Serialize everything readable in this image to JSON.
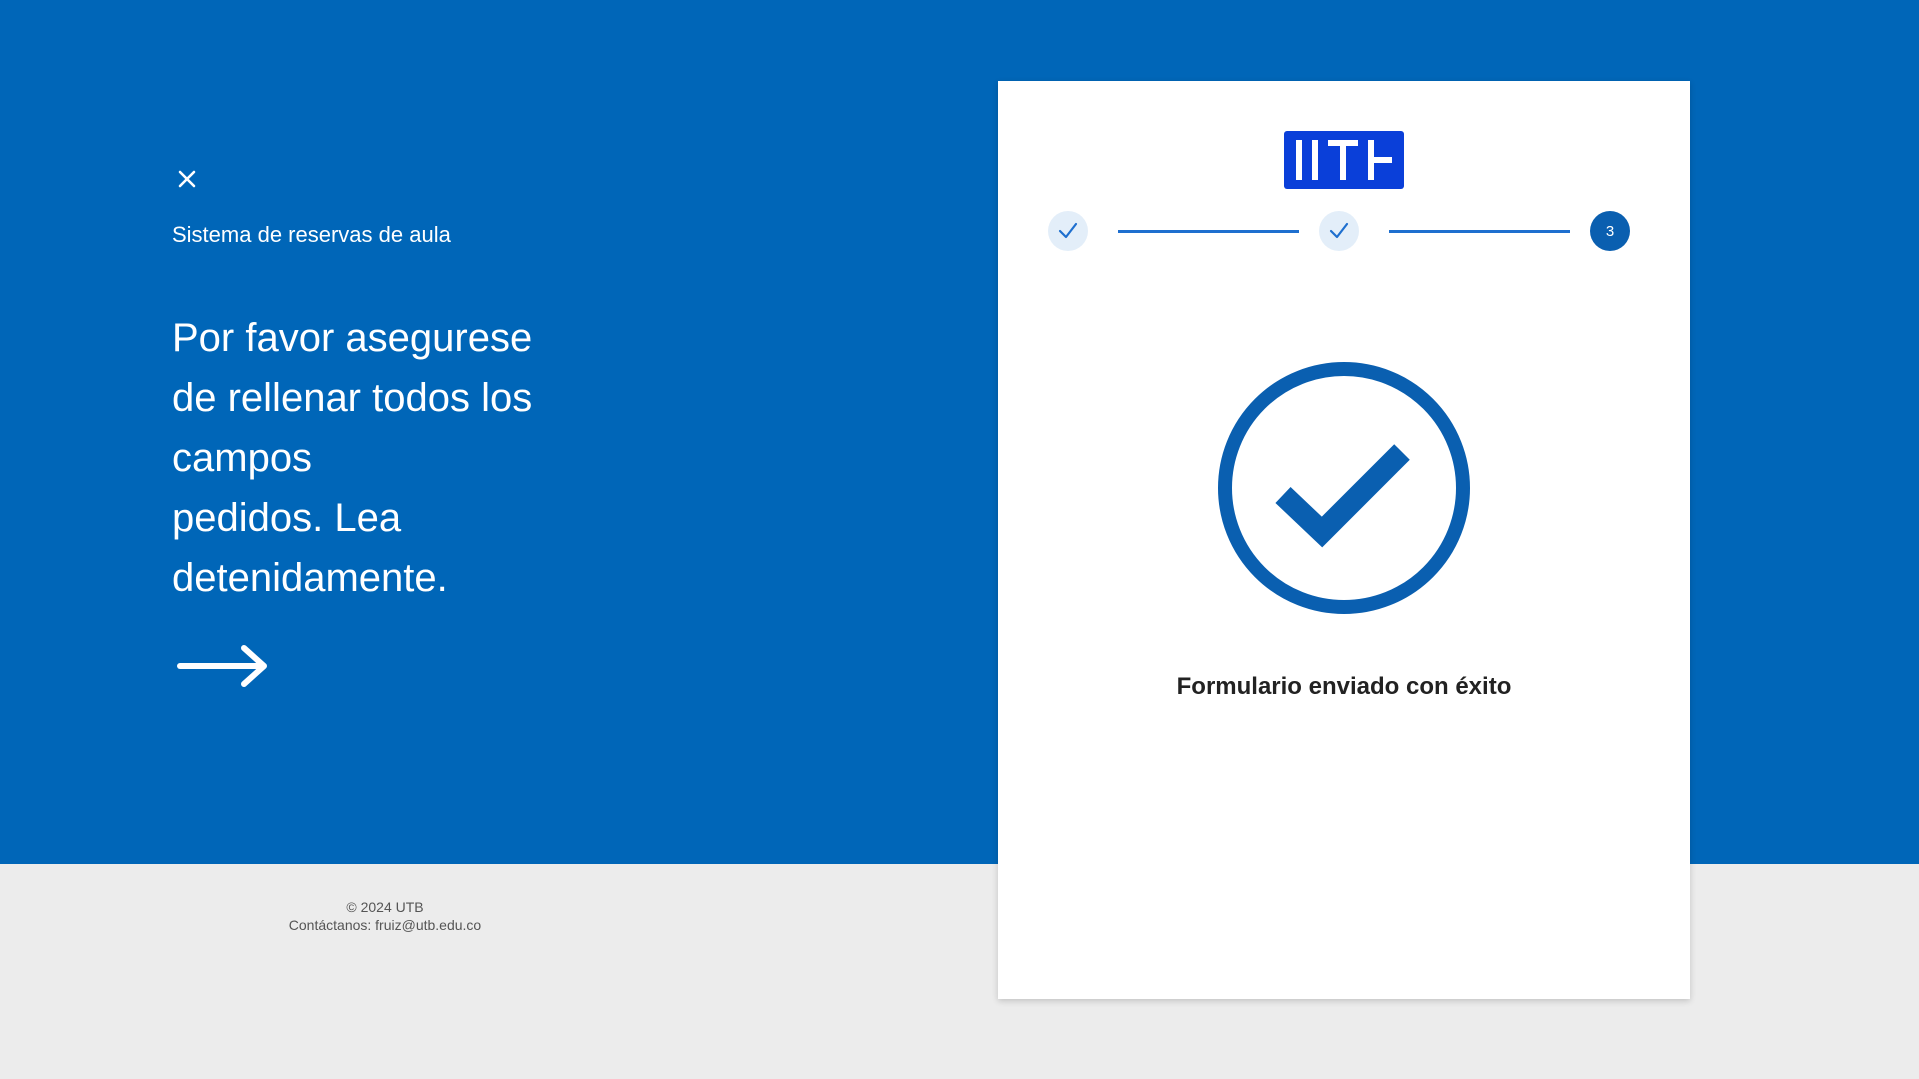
{
  "hero": {
    "close_icon": "close-icon",
    "app_name": "Sistema de reservas de aula",
    "message_lines": [
      "Por favor asegurese",
      "de rellenar todos los",
      "campos",
      "pedidos. Lea",
      "detenidamente."
    ],
    "arrow_icon": "arrow-right-icon",
    "background_color": "#0066b8"
  },
  "footer": {
    "copyright": "© 2024 UTB",
    "contact": "Contáctanos: fruiz@utb.edu.co"
  },
  "card": {
    "logo_text": "UTB",
    "logo_color": "#0a3fd9",
    "steps": [
      {
        "status": "completed",
        "icon": "check-icon"
      },
      {
        "status": "completed",
        "icon": "check-icon"
      },
      {
        "status": "active",
        "label": "3"
      }
    ],
    "success_icon": "check-circle-icon",
    "success_message": "Formulario enviado con éxito",
    "accent_color": "#0a5fb0"
  }
}
